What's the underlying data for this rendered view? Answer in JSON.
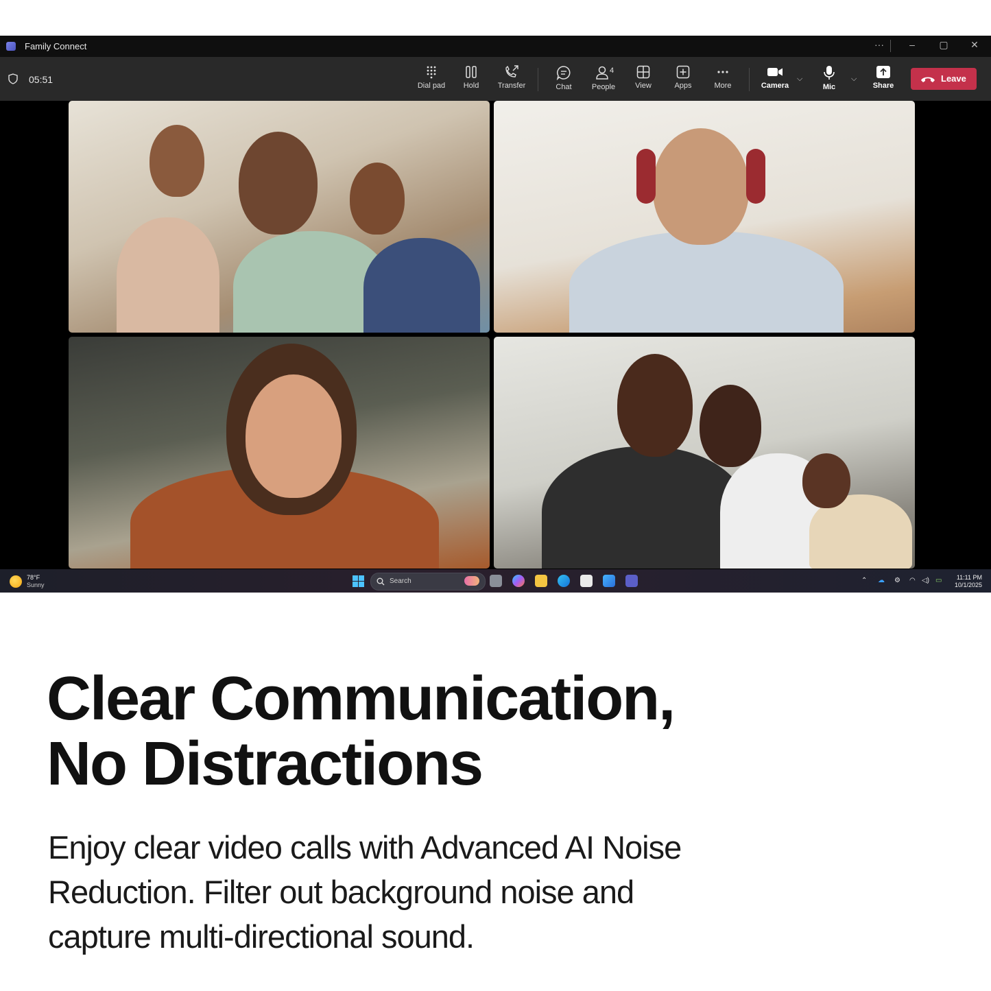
{
  "window": {
    "title": "Family Connect"
  },
  "toolbar": {
    "timer": "05:51",
    "buttons": [
      {
        "label": "Dial pad",
        "icon": "dialpad-icon"
      },
      {
        "label": "Hold",
        "icon": "hold-icon"
      },
      {
        "label": "Transfer",
        "icon": "transfer-icon"
      },
      {
        "label": "Chat",
        "icon": "chat-icon"
      },
      {
        "label": "People",
        "icon": "people-icon",
        "count": "4"
      },
      {
        "label": "View",
        "icon": "view-icon"
      },
      {
        "label": "Apps",
        "icon": "apps-icon"
      },
      {
        "label": "More",
        "icon": "more-icon"
      },
      {
        "label": "Camera",
        "icon": "camera-icon"
      },
      {
        "label": "Mic",
        "icon": "mic-icon"
      },
      {
        "label": "Share",
        "icon": "share-icon"
      }
    ],
    "leave_label": "Leave",
    "leave_color": "#c4314b"
  },
  "taskbar": {
    "weather_temp": "78°F",
    "weather_condition": "Sunny",
    "search_placeholder": "Search",
    "time": "11:11 PM",
    "date": "10/1/2025"
  },
  "marketing": {
    "headline_line1": "Clear Communication,",
    "headline_line2": "No Distractions",
    "body_line1": "Enjoy clear video calls with Advanced AI Noise",
    "body_line2": "Reduction. Filter out background noise and",
    "body_line3": "capture multi-directional sound."
  }
}
